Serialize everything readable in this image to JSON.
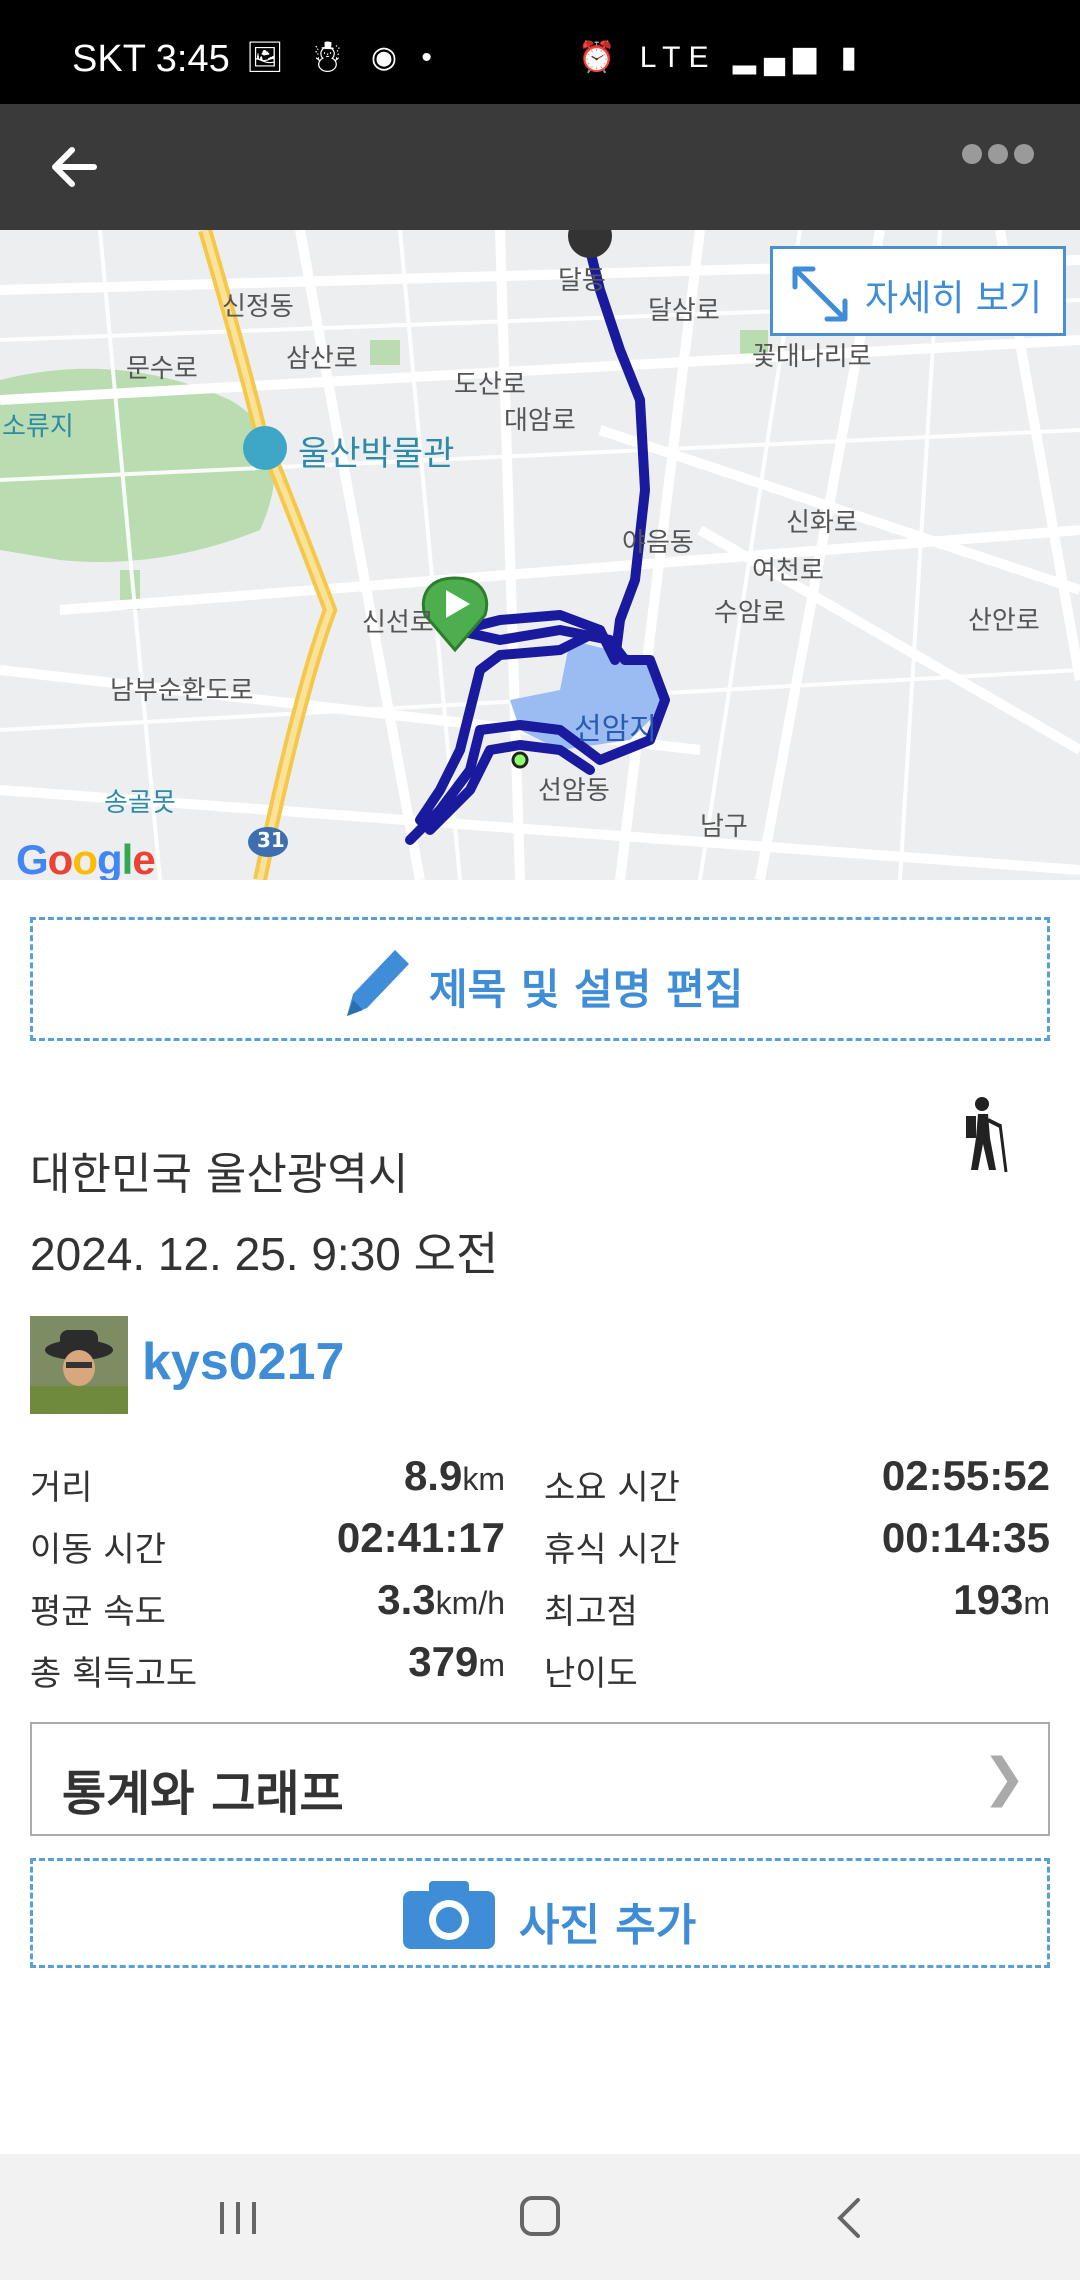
{
  "status_bar": {
    "carrier_time": "SKT 3:45",
    "left_icons": "🖼 ☃ ◉ •",
    "right_icons": "⏰ LTE ▂▄▆ ▮"
  },
  "app_bar": {
    "back_icon": "arrow-left-icon",
    "more_icon": "more-dots-icon"
  },
  "map": {
    "detail_button_label": "자세히 보기",
    "google_logo": "Google",
    "labels": {
      "sinjeong": "신정동",
      "dalsam": "달삼로",
      "munsu": "문수로",
      "samsan": "삼산로",
      "dosan": "도산로",
      "museum": "울산박물관",
      "daeam": "대암로",
      "kkotdae": "꽃대나리로",
      "sinseon": "신선로",
      "yaeum": "야음동",
      "sinhwa": "신화로",
      "yeocheon": "여천로",
      "suam": "수암로",
      "seonamji": "선암지",
      "seonamdong": "선암동",
      "nambu": "남부순환도로",
      "songgol": "송골못",
      "namgu": "남구",
      "route31": "31",
      "sanan": "산안로",
      "soryuji": "소류지",
      "dal": "달동"
    }
  },
  "edit_button_label": "제목 및 설명 편집",
  "location": "대한민국 울산광역시",
  "datetime": "2024. 12. 25. 9:30 오전",
  "user": {
    "name": "kys0217"
  },
  "stats": {
    "rows": [
      {
        "l1": "거리",
        "v1": "8.9",
        "u1": "km",
        "l2": "소요 시간",
        "v2": "02:55:52",
        "u2": ""
      },
      {
        "l1": "이동 시간",
        "v1": "02:41:17",
        "u1": "",
        "l2": "휴식 시간",
        "v2": "00:14:35",
        "u2": ""
      },
      {
        "l1": "평균 속도",
        "v1": "3.3",
        "u1": "km/h",
        "l2": "최고점",
        "v2": "193",
        "u2": "m"
      },
      {
        "l1": "총 획득고도",
        "v1": "379",
        "u1": "m",
        "l2": "난이도",
        "v2": "",
        "u2": ""
      }
    ]
  },
  "graph_button_label": "통계와 그래프",
  "graph_chevron": "❯",
  "photo_button_label": "사진 추가",
  "colors": {
    "accent": "#3f8dd6",
    "route": "#1a1a9e",
    "app_bar": "#3a3a3a"
  }
}
